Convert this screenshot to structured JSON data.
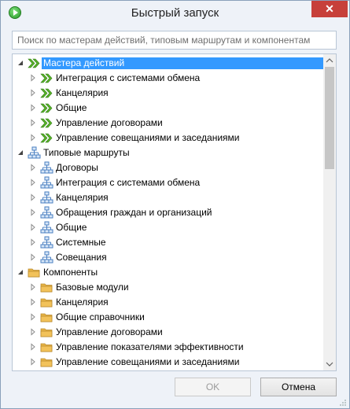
{
  "window": {
    "title": "Быстрый запуск",
    "close_label": "✕"
  },
  "search": {
    "placeholder": "Поиск по мастерам действий, типовым маршрутам и компонентам",
    "value": ""
  },
  "tree": [
    {
      "label": "Мастера действий",
      "level": 0,
      "icon": "wizard-icon",
      "expander": "expanded",
      "selected": true
    },
    {
      "label": "Интеграция с системами обмена",
      "level": 1,
      "icon": "wizard-icon",
      "expander": "collapsed"
    },
    {
      "label": "Канцелярия",
      "level": 1,
      "icon": "wizard-icon",
      "expander": "collapsed"
    },
    {
      "label": "Общие",
      "level": 1,
      "icon": "wizard-icon",
      "expander": "collapsed"
    },
    {
      "label": "Управление договорами",
      "level": 1,
      "icon": "wizard-icon",
      "expander": "collapsed"
    },
    {
      "label": "Управление совещаниями и заседаниями",
      "level": 1,
      "icon": "wizard-icon",
      "expander": "collapsed"
    },
    {
      "label": "Типовые маршруты",
      "level": 0,
      "icon": "route-icon",
      "expander": "expanded"
    },
    {
      "label": "Договоры",
      "level": 1,
      "icon": "route-icon",
      "expander": "collapsed"
    },
    {
      "label": "Интеграция с системами обмена",
      "level": 1,
      "icon": "route-icon",
      "expander": "collapsed"
    },
    {
      "label": "Канцелярия",
      "level": 1,
      "icon": "route-icon",
      "expander": "collapsed"
    },
    {
      "label": "Обращения граждан и организаций",
      "level": 1,
      "icon": "route-icon",
      "expander": "collapsed"
    },
    {
      "label": "Общие",
      "level": 1,
      "icon": "route-icon",
      "expander": "collapsed"
    },
    {
      "label": "Системные",
      "level": 1,
      "icon": "route-icon",
      "expander": "collapsed"
    },
    {
      "label": "Совещания",
      "level": 1,
      "icon": "route-icon",
      "expander": "collapsed"
    },
    {
      "label": "Компоненты",
      "level": 0,
      "icon": "folder-icon",
      "expander": "expanded"
    },
    {
      "label": "Базовые модули",
      "level": 1,
      "icon": "folder-icon",
      "expander": "collapsed"
    },
    {
      "label": "Канцелярия",
      "level": 1,
      "icon": "folder-icon",
      "expander": "collapsed"
    },
    {
      "label": "Общие справочники",
      "level": 1,
      "icon": "folder-icon",
      "expander": "collapsed"
    },
    {
      "label": "Управление договорами",
      "level": 1,
      "icon": "folder-icon",
      "expander": "collapsed"
    },
    {
      "label": "Управление показателями эффективности",
      "level": 1,
      "icon": "folder-icon",
      "expander": "collapsed"
    },
    {
      "label": "Управление совещаниями и заседаниями",
      "level": 1,
      "icon": "folder-icon",
      "expander": "collapsed"
    }
  ],
  "scrollbar": {
    "position": 0.0,
    "visible_fraction": 0.35
  },
  "buttons": {
    "ok": "OK",
    "cancel": "Отмена"
  },
  "colors": {
    "selection": "#3399ff",
    "close_button": "#c7403a",
    "wizard_icon": "#5ab52a",
    "folder_icon": "#f2c25a",
    "route_icon": "#4a7fc1"
  }
}
